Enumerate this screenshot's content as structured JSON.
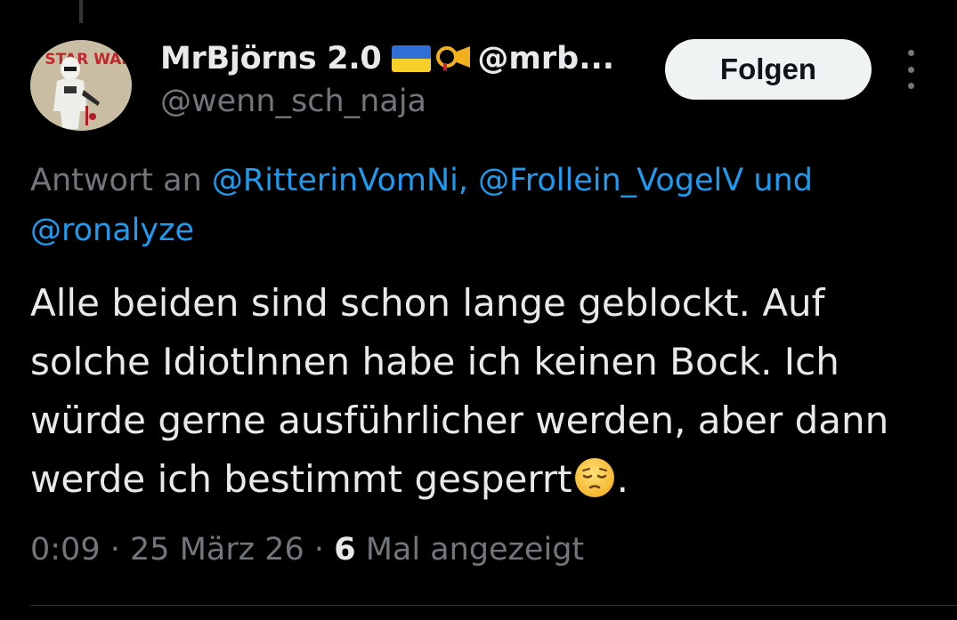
{
  "tweet": {
    "author": {
      "display_name": "MrBjörns 2.0",
      "display_name_suffix": "@mrb...",
      "username": "@wenn_sch_naja",
      "avatar_text": "STAR WARS"
    },
    "follow_label": "Folgen",
    "reply_prefix": "Antwort an",
    "reply_mentions": [
      "@RitterinVomNi,",
      "@Frollein_VogelV",
      "und",
      "@ronalyze"
    ],
    "text_main": "Alle beiden sind schon lange geblockt. Auf solche IdiotInnen habe ich keinen Bock. Ich würde gerne ausführlicher werden, aber dann werde ich bestimmt gesperrt",
    "text_end": ".",
    "time": "0:09",
    "separator": "·",
    "date": "25 März 26",
    "views_count": "6",
    "views_label": "Mal angezeigt"
  },
  "colors": {
    "background": "#000000",
    "text_primary": "#e7e9ea",
    "text_secondary": "#71767b",
    "accent": "#1d9bf0",
    "button_bg": "#eff3f4"
  },
  "icons": {
    "flag": "ukraine-flag-icon",
    "horn": "post-horn-icon",
    "more": "more-options-icon",
    "emoji": "pensive-face-emoji"
  }
}
